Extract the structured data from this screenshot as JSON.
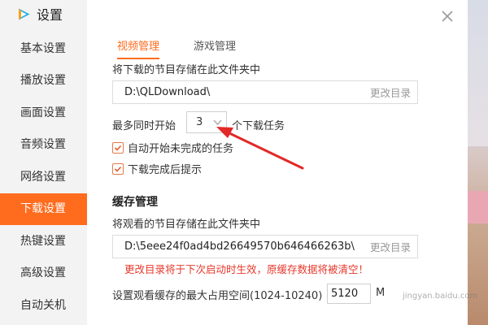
{
  "window": {
    "title": "设置",
    "logo_color": "#23b3e8",
    "accent": "#ff6c1e"
  },
  "sidebar": {
    "items": [
      {
        "label": "基本设置",
        "active": false
      },
      {
        "label": "播放设置",
        "active": false
      },
      {
        "label": "画面设置",
        "active": false
      },
      {
        "label": "音频设置",
        "active": false
      },
      {
        "label": "网络设置",
        "active": false
      },
      {
        "label": "下载设置",
        "active": true
      },
      {
        "label": "热键设置",
        "active": false
      },
      {
        "label": "高级设置",
        "active": false
      },
      {
        "label": "自动关机",
        "active": false
      }
    ]
  },
  "tabs": [
    {
      "label": "视频管理",
      "active": true
    },
    {
      "label": "游戏管理",
      "active": false
    }
  ],
  "download": {
    "folder_label": "将下载的节目存储在此文件夹中",
    "folder_path": "D:\\QLDownload\\",
    "change_label": "更改目录",
    "concurrent_prefix": "最多同时开始",
    "concurrent_value": "3",
    "concurrent_suffix": "个下载任务",
    "auto_start_label": "自动开始未完成的任务",
    "auto_start_checked": true,
    "notify_label": "下载完成后提示",
    "notify_checked": true
  },
  "cache": {
    "section_title": "缓存管理",
    "folder_label": "将观看的节目存储在此文件夹中",
    "folder_path": "D:\\5eee24f0ad4bd26649570b646466263b\\",
    "change_label": "更改目录",
    "warning": "更改目录将于下次启动时生效，原缓存数据将被清空！",
    "max_space_label": "设置观看缓存的最大占用空间(1024-10240)",
    "max_space_value": "5120",
    "unit": "M"
  },
  "watermark": {
    "text": "Baidu",
    "sub": "jingyan.baidu.com"
  },
  "icons": {
    "logo": "tencent-video-play-icon",
    "close": "close-icon",
    "dropdown": "chevron-down-icon",
    "check": "checkmark-icon",
    "annotation": "red-arrow-annotation"
  }
}
